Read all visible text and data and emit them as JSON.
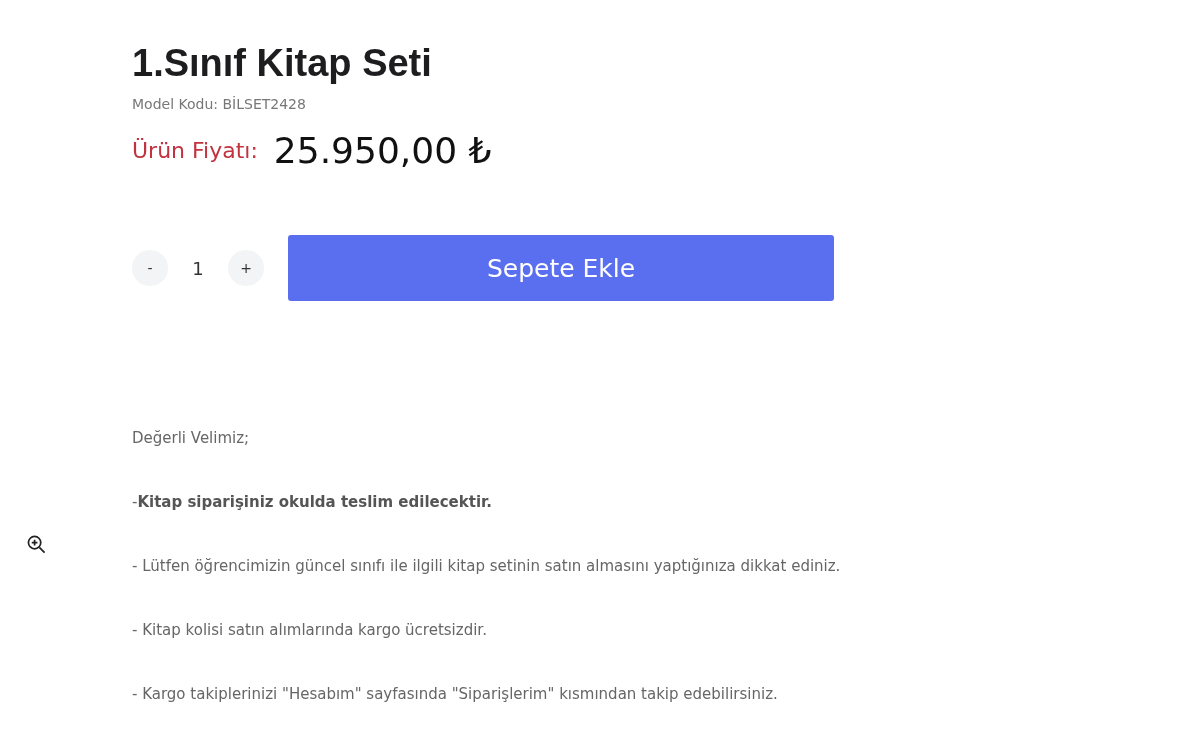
{
  "product": {
    "title": "1.Sınıf Kitap Seti",
    "model_code": "Model Kodu: BİLSET2428",
    "price_label": "Ürün Fiyatı:",
    "price": "25.950,00 ₺"
  },
  "quantity": {
    "decrease": "-",
    "value": "1",
    "increase": "+"
  },
  "add_to_cart": "Sepete Ekle",
  "description": [
    "Değerli Velimiz;",
    "-**Kitap siparişiniz okulda teslim edilecektir.**",
    "- Lütfen öğrencimizin güncel sınıfı ile ilgili kitap setinin satın almasını yaptığınıza dikkat ediniz.",
    "- Kitap kolisi satın alımlarında kargo ücretsizdir.",
    "- Kargo takiplerinizi \"Hesabım\" sayfasında \"Siparişlerim\" kısmından takip edebilirsiniz."
  ]
}
